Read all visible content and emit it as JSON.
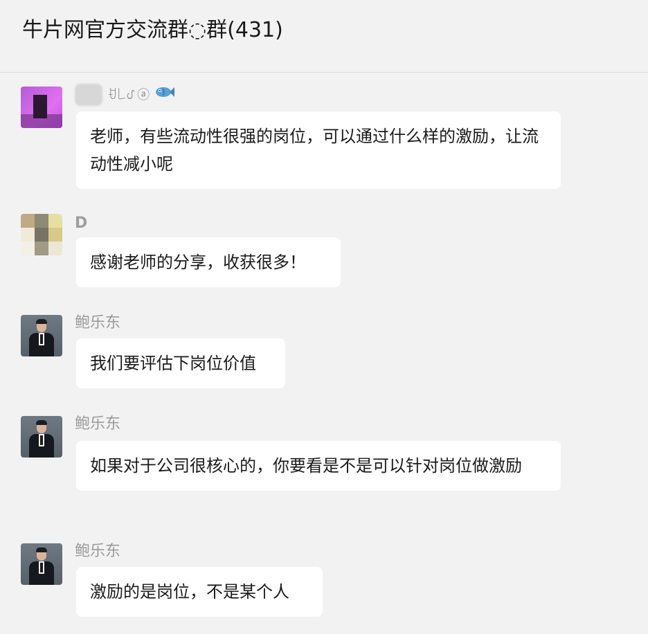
{
  "header": {
    "title": "牛片网官方交流群◌群(431)"
  },
  "messages": [
    {
      "sender": "ꀀ꒒ᦔ ⓐ",
      "sender_icon": "fish-emoji",
      "text": "老师，有些流动性很强的岗位，可以通过什么样的激励，让流动性减小呢"
    },
    {
      "sender": "D",
      "text": "感谢老师的分享，收获很多！"
    },
    {
      "sender": "鲍乐东",
      "text": "我们要评估下岗位价值"
    },
    {
      "sender": "鲍乐东",
      "text": "如果对于公司很核心的，你要看是不是可以针对岗位做激励"
    },
    {
      "sender": "鲍乐东",
      "text": "激励的是岗位，不是某个人"
    }
  ],
  "colors": {
    "background": "#f2f2f2",
    "bubble": "#ffffff",
    "sender_name": "#9a9a9a",
    "text": "#1a1a1a"
  }
}
